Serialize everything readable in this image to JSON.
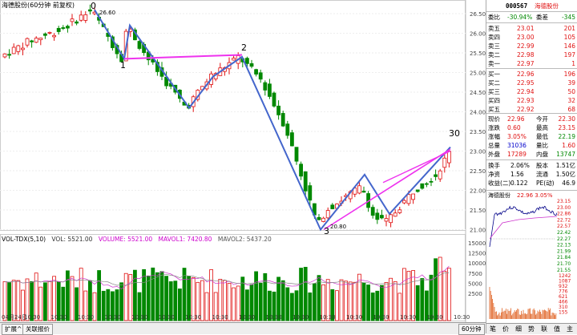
{
  "chart": {
    "title": "海德股份(60分钟 前复权)",
    "right_axis_labels": [
      "26.50",
      "26.00",
      "25.50",
      "25.00",
      "24.50",
      "24.00",
      "23.50",
      "23.00",
      "22.50",
      "22.00",
      "21.50",
      "21.00"
    ],
    "vol_axis_labels": [
      "15000",
      "12500",
      "10000",
      "7500",
      "5000",
      "2500"
    ],
    "wave_labels": [
      "0",
      "1",
      "2",
      "3",
      "30"
    ],
    "price_annotations": [
      "26.60",
      "20.80"
    ],
    "date_first": "04月24日",
    "time_ticks": [
      "10:30",
      "10:30",
      "10:30",
      "10:30",
      "10:30",
      "10:30",
      "10:30",
      "10:30",
      "10:30",
      "10:30",
      "10:30",
      "10:30",
      "10:30",
      "10:30",
      "10:30",
      "10:30",
      "10:30"
    ],
    "colors": {
      "up": "#e01010",
      "down": "#008800",
      "wave": "#4466cc",
      "trend": "#ee33ee"
    }
  },
  "volume": {
    "name": "VOL-TDX(5,10)",
    "vol": "VOL: 5521.00",
    "volume": "VOLUME: 5521.00",
    "mavol1": "MAVOL1: 7420.80",
    "mavol2": "MAVOL2: 5437.20"
  },
  "bottom_tabs": [
    "扩展^",
    "关联报价"
  ],
  "tab_60min": "60分钟",
  "stock": {
    "code": "000567",
    "name": "海德股份"
  },
  "order_ratio": {
    "label1": "委比",
    "value1": "-30.94%",
    "label2": "委差",
    "value2": "-345"
  },
  "asks": [
    {
      "label": "卖五",
      "price": "23.01",
      "vol": "201"
    },
    {
      "label": "卖四",
      "price": "23.00",
      "vol": "105"
    },
    {
      "label": "卖三",
      "price": "22.99",
      "vol": "146"
    },
    {
      "label": "卖二",
      "price": "22.98",
      "vol": "197"
    },
    {
      "label": "卖一",
      "price": "22.97",
      "vol": "1"
    }
  ],
  "bids": [
    {
      "label": "买一",
      "price": "22.96",
      "vol": "196"
    },
    {
      "label": "买二",
      "price": "22.95",
      "vol": "39"
    },
    {
      "label": "买三",
      "price": "22.94",
      "vol": "50"
    },
    {
      "label": "买四",
      "price": "22.93",
      "vol": "32"
    },
    {
      "label": "买五",
      "price": "22.92",
      "vol": "68"
    }
  ],
  "quote": [
    {
      "l1": "现价",
      "v1": "22.96",
      "l2": "今开",
      "v2": "22.30"
    },
    {
      "l1": "涨跌",
      "v1": "0.60",
      "l2": "最高",
      "v2": "23.15"
    },
    {
      "l1": "涨幅",
      "v1": "3.05%",
      "l2": "最低",
      "v2": "22.19"
    },
    {
      "l1": "总量",
      "v1": "31036",
      "l2": "量比",
      "v2": "1.60"
    },
    {
      "l1": "外盘",
      "v1": "17289",
      "l2": "内盘",
      "v2": "13747"
    }
  ],
  "fundamentals": [
    {
      "l1": "换手",
      "v1": "2.06%",
      "l2": "股本",
      "v2": "1.51亿"
    },
    {
      "l1": "净资",
      "v1": "1.56",
      "l2": "流通",
      "v2": "1.50亿"
    },
    {
      "l1": "收益(二)",
      "v1": "0.122",
      "l2": "PE(动)",
      "v2": "46.9"
    }
  ],
  "mini_chart": {
    "title": "海德股份",
    "quote": "22.96 3.05%",
    "price_axis": [
      "23.15",
      "23.00",
      "22.86",
      "22.72",
      "22.57",
      "22.42",
      "22.27",
      "22.13",
      "21.99",
      "21.84",
      "21.70",
      "21.55"
    ],
    "vol_axis": [
      "1242",
      "1087",
      "932",
      "776",
      "621",
      "466",
      "310",
      "155"
    ]
  },
  "panel_tabs": [
    "笔",
    "价",
    "细",
    "势",
    "联",
    "值",
    "主"
  ]
}
